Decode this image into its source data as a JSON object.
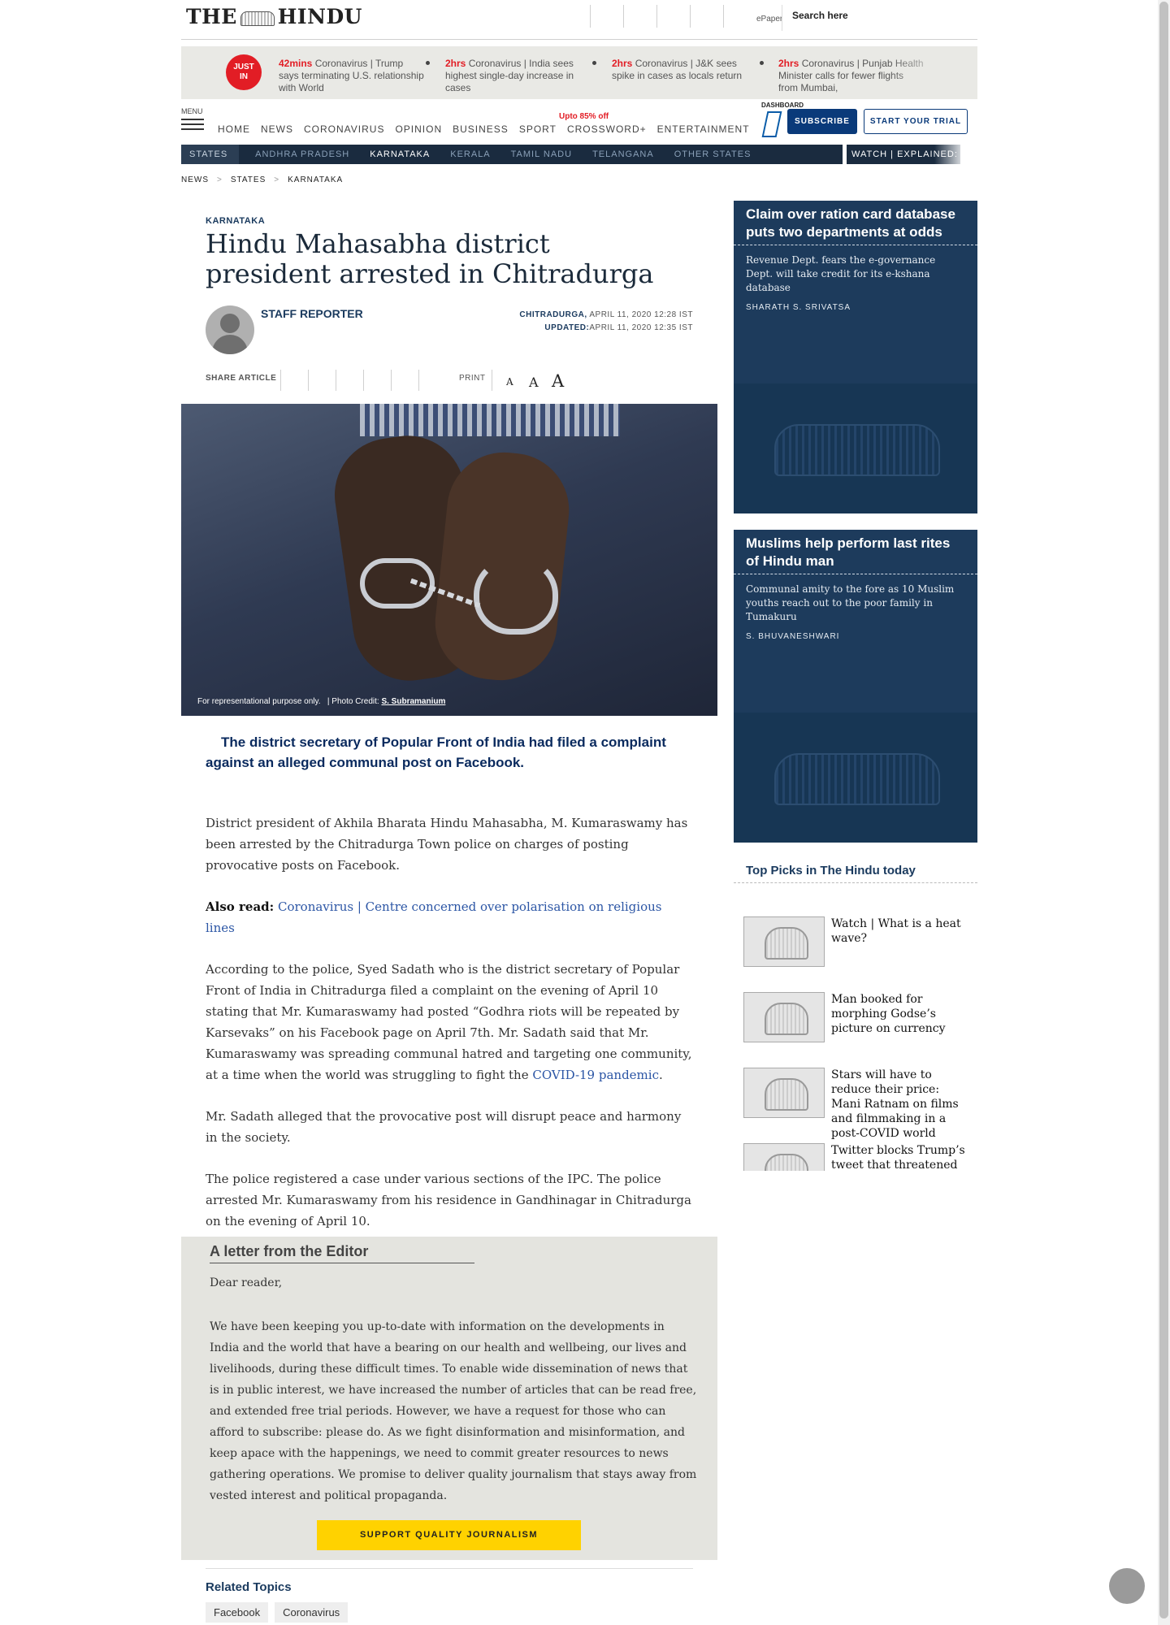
{
  "header": {
    "logo_left": "THE",
    "logo_right": "HINDU",
    "epaper": "ePaper",
    "search_placeholder": "Search here"
  },
  "just_in": {
    "badge_line1": "JUST",
    "badge_line2": "IN",
    "items": [
      {
        "time": "42mins",
        "text": "Coronavirus | Trump says terminating U.S. relationship with World"
      },
      {
        "time": "2hrs",
        "text": "Coronavirus | India sees highest single-day increase in cases"
      },
      {
        "time": "2hrs",
        "text": "Coronavirus | J&K sees spike in cases as locals return"
      },
      {
        "time": "2hrs",
        "text": "Coronavirus | Punjab Health Minister calls for fewer flights from Mumbai,"
      }
    ]
  },
  "nav": {
    "menu_label": "MENU",
    "links": [
      "HOME",
      "NEWS",
      "CORONAVIRUS",
      "OPINION",
      "BUSINESS",
      "SPORT",
      "CROSSWORD+",
      "ENTERTAINMENT"
    ],
    "promo": "Upto 85% off",
    "dashboard": "DASHBOARD",
    "subscribe": "SUBSCRIBE",
    "trial": "START YOUR TRIAL"
  },
  "states_bar": {
    "first": "STATES",
    "items": [
      "ANDHRA PRADESH",
      "KARNATAKA",
      "KERALA",
      "TAMIL NADU",
      "TELANGANA",
      "OTHER STATES"
    ],
    "active": "KARNATAKA",
    "watch": "WATCH",
    "explained": "EXPLAINED:"
  },
  "breadcrumb": [
    "NEWS",
    "STATES",
    "KARNATAKA"
  ],
  "article": {
    "kicker": "KARNATAKA",
    "headline": "Hindu Mahasabha district president arrested in Chitradurga",
    "author": "STAFF REPORTER",
    "place": "CHITRADURGA,",
    "date": "APRIL 11, 2020 12:28 IST",
    "updated_label": "UPDATED:",
    "updated": "APRIL 11, 2020 12:35 IST",
    "share_label": "SHARE ARTICLE",
    "print": "PRINT",
    "font_sizes": [
      "A",
      "A",
      "A"
    ],
    "caption": "For representational purpose only.",
    "photo_credit_label": "| Photo Credit:",
    "photo_credit": "S. Subramanium",
    "lede": "The district secretary of Popular Front of India had filed a complaint against an alleged communal post on Facebook.",
    "p1": "District president of Akhila Bharata Hindu Mahasabha, M. Kumaraswamy has been arrested by the Chitradurga Town police on charges of posting provocative posts on Facebook.",
    "also_read_label": "Also read:",
    "also_read_link": "Coronavirus | Centre concerned over polarisation on religious lines",
    "p2": "According to the police, Syed Sadath who is the district secretary of Popular Front of India in Chitradurga filed a complaint on the evening of April 10 stating that Mr. Kumaraswamy had posted “Godhra riots will be repeated by Karsevaks” on his Facebook page on April 7th. Mr. Sadath said that Mr. Kumaraswamy was spreading communal hatred and targeting one community, at a time when the world was struggling to fight the",
    "p2_link": "COVID-19 pandemic",
    "p2_end": ".",
    "p3": "Mr. Sadath alleged that the provocative post will disrupt peace and harmony in the society.",
    "p4": "The police registered a case under various sections of the IPC. The police arrested Mr. Kumaraswamy from his residence in Gandhinagar in Chitradurga on the evening of April 10."
  },
  "editor_letter": {
    "title": "A letter from the Editor",
    "greeting": "Dear reader,",
    "body": "We have been keeping you up-to-date with information on the developments in India and the world that have a bearing on our health and wellbeing, our lives and livelihoods, during these difficult times. To enable wide dissemination of news that is in public interest, we have increased the number of articles that can be read free, and extended free trial periods. However, we have a request for those who can afford to subscribe: please do. As we fight disinformation and misinformation, and keep apace with the happenings, we need to commit greater resources to news gathering operations. We promise to deliver quality journalism that stays away from vested interest and political propaganda.",
    "button": "SUPPORT QUALITY JOURNALISM"
  },
  "related": {
    "title": "Related Topics",
    "tags": [
      "Facebook",
      "Coronavirus"
    ]
  },
  "sidebar": {
    "cards": [
      {
        "title": "Claim over ration card database puts two departments at odds",
        "desc": "Revenue Dept. fears the e-governance Dept. will take credit for its e-kshana database",
        "byline": "SHARATH S. SRIVATSA"
      },
      {
        "title": "Muslims help perform last rites of Hindu man",
        "desc": "Communal amity to the fore as 10 Muslim youths reach out to the poor family in Tumakuru",
        "byline": "S. BHUVANESHWARI"
      }
    ],
    "picks_title": "Top Picks in The Hindu today",
    "picks": [
      "Watch | What is a heat wave?",
      "Man booked for morphing Godse’s picture on currency",
      "Stars will have to reduce their price: Mani Ratnam on films and filmmaking in a post-COVID world",
      "Twitter blocks Trump’s tweet that threatened to"
    ]
  },
  "colors": {
    "brand_navy": "#1a3a5e",
    "accent_red": "#e21d25",
    "support_yellow": "#ffd200",
    "card_blue": "#1d3b5c"
  }
}
